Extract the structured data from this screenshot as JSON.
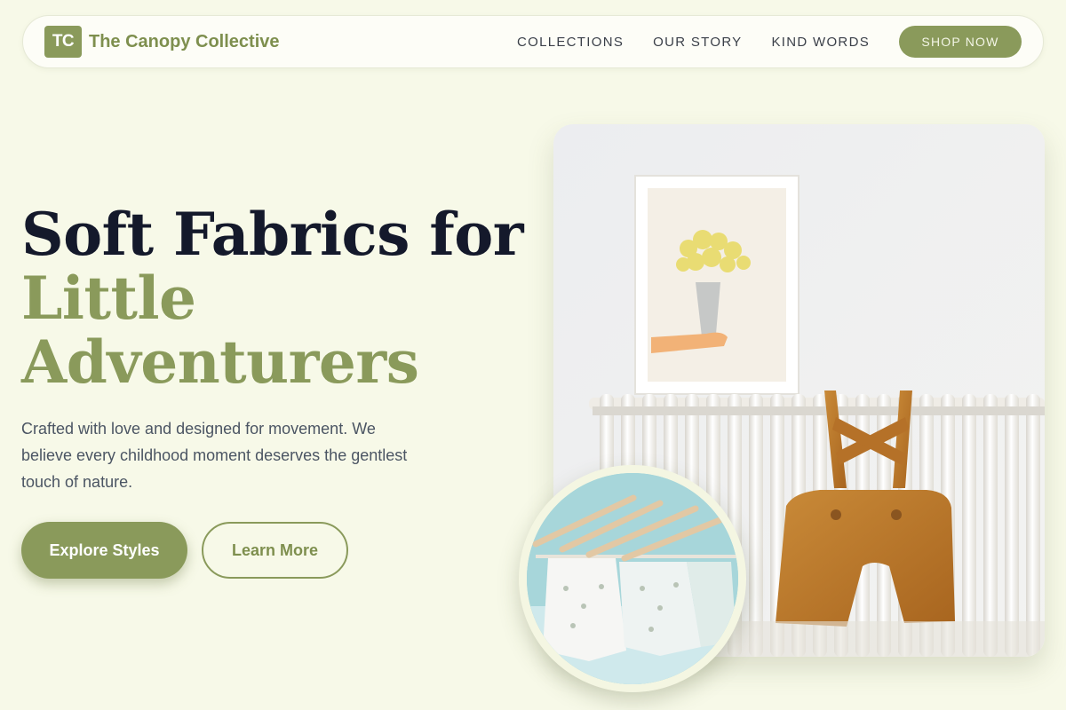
{
  "brand": {
    "logo_initials": "TC",
    "name": "The Canopy Collective"
  },
  "nav": {
    "links": [
      "COLLECTIONS",
      "OUR STORY",
      "KIND WORDS"
    ],
    "cta": "SHOP NOW"
  },
  "hero": {
    "headline_line1": "Soft Fabrics for",
    "headline_line2": "Little",
    "headline_line3": "Adventurers",
    "description": "Crafted with love and designed for movement. We believe every childhood moment deserves the gentlest touch of nature.",
    "primary_button": "Explore Styles",
    "secondary_button": "Learn More"
  },
  "colors": {
    "background": "#f7f9e8",
    "accent": "#8a9a5b",
    "headline_dark": "#14192b"
  },
  "icons": {
    "hero_image": "nursery-radiator-overalls-photo",
    "inset_image": "baby-clothes-on-hangers-photo"
  }
}
